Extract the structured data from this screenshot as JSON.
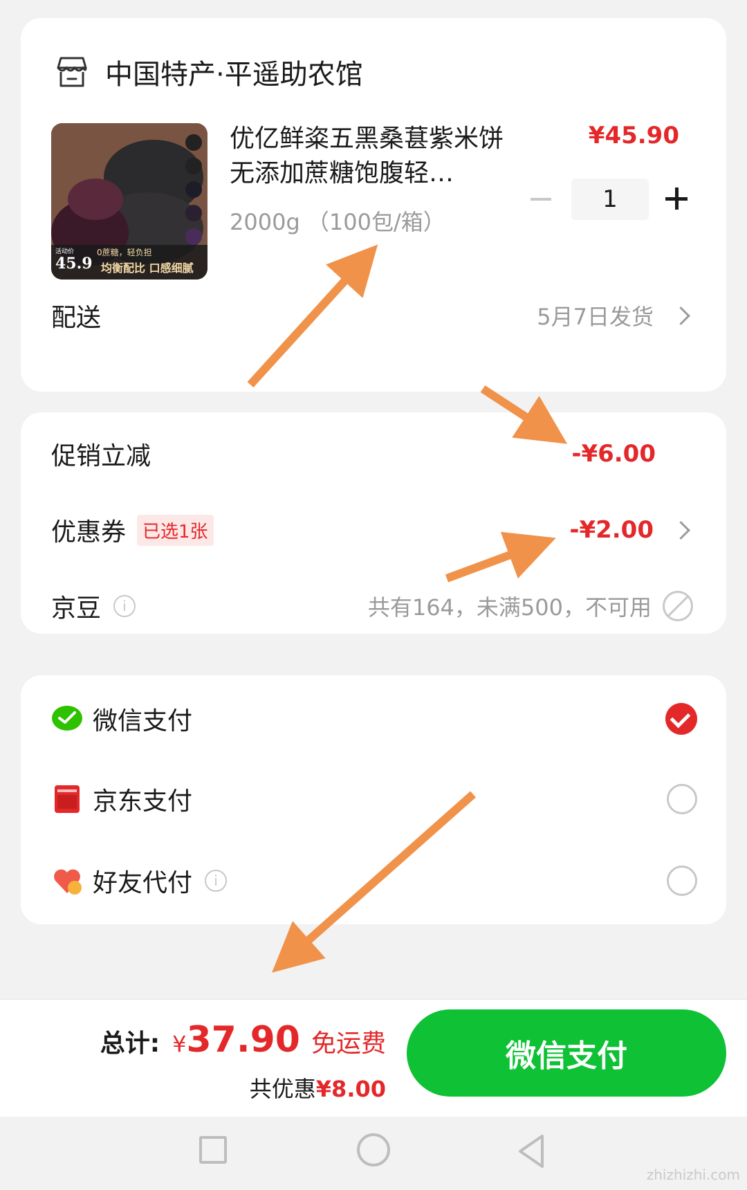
{
  "shop": {
    "name": "中国特产·平遥助农馆",
    "icon": "store-icon"
  },
  "product": {
    "title": "优亿鲜粢五黑桑葚紫米饼无添加蔗糖饱腹轻…",
    "spec": "2000g （100包/箱）",
    "price": "¥45.90",
    "quantity": "1",
    "image": {
      "badge_label": "活动价",
      "badge_price": "45.9",
      "caption": "0蔗糖，轻负担",
      "slogan": "均衡配比 口感细腻"
    }
  },
  "delivery": {
    "label": "配送",
    "value": "5月7日发货"
  },
  "discounts": {
    "promo": {
      "label": "促销立减",
      "amount": "-¥6.00"
    },
    "coupon": {
      "label": "优惠券",
      "tag": "已选1张",
      "amount": "-¥2.00"
    },
    "jingdou": {
      "label": "京豆",
      "info_icon": "i",
      "status": "共有164，未满500，不可用"
    }
  },
  "payment": {
    "options": [
      {
        "label": "微信支付",
        "icon": "wechat-icon",
        "selected": true
      },
      {
        "label": "京东支付",
        "icon": "jd-pay-icon",
        "selected": false
      },
      {
        "label": "好友代付",
        "icon": "friend-pay-icon",
        "selected": false
      }
    ],
    "info_icon": "i"
  },
  "summary": {
    "total_label": "总计:",
    "currency": "¥",
    "total_amount": "37.90",
    "free_shipping": "免运费",
    "saving_label": "共优惠",
    "saving_amount": "¥8.00",
    "pay_button": "微信支付"
  },
  "watermark": "zhizhizhi.com",
  "colors": {
    "accent_red": "#e4282a",
    "wechat_green": "#0ec135",
    "arrow_orange": "#f0924a"
  }
}
